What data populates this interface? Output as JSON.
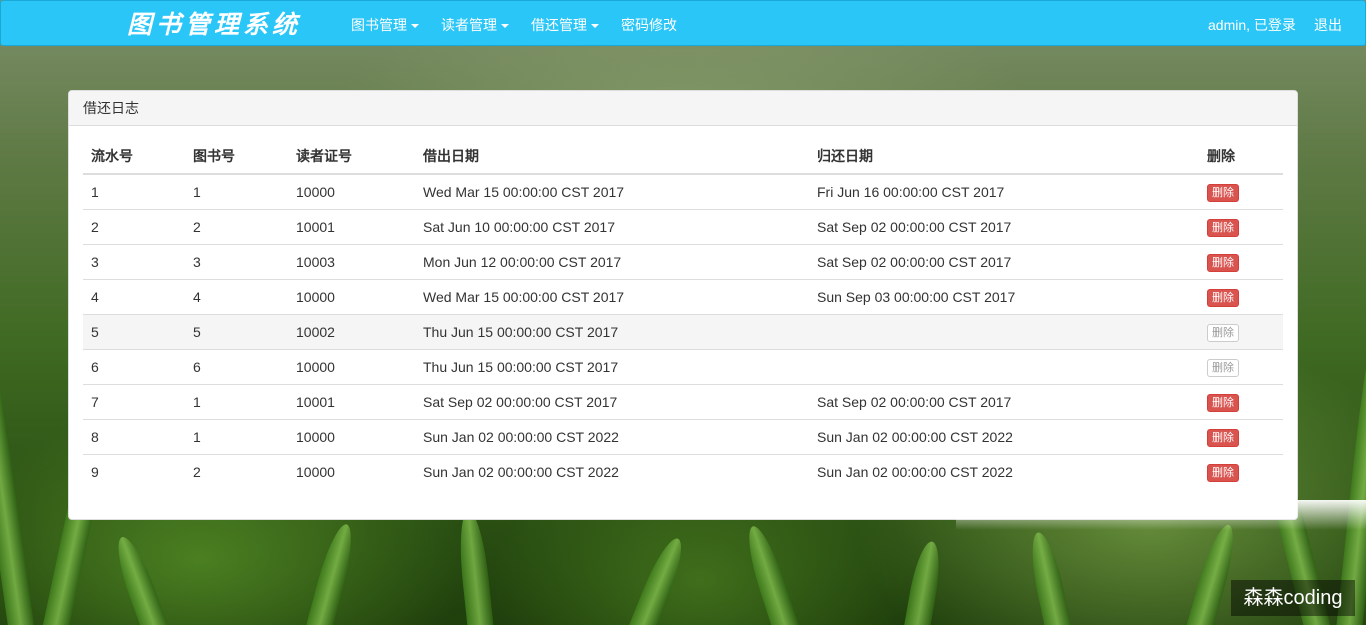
{
  "brand": "图书管理系统",
  "nav": {
    "items": [
      {
        "label": "图书管理",
        "dropdown": true
      },
      {
        "label": "读者管理",
        "dropdown": true
      },
      {
        "label": "借还管理",
        "dropdown": true
      },
      {
        "label": "密码修改",
        "dropdown": false
      }
    ],
    "user": "admin, 已登录",
    "logout": "退出"
  },
  "panel": {
    "title": "借还日志",
    "columns": [
      "流水号",
      "图书号",
      "读者证号",
      "借出日期",
      "归还日期",
      "删除"
    ],
    "rows": [
      {
        "sernum": "1",
        "book_id": "1",
        "reader_id": "10000",
        "lend_date": "Wed Mar 15 00:00:00 CST 2017",
        "back_date": "Fri Jun 16 00:00:00 CST 2017",
        "action": "删除",
        "enabled": true
      },
      {
        "sernum": "2",
        "book_id": "2",
        "reader_id": "10001",
        "lend_date": "Sat Jun 10 00:00:00 CST 2017",
        "back_date": "Sat Sep 02 00:00:00 CST 2017",
        "action": "删除",
        "enabled": true
      },
      {
        "sernum": "3",
        "book_id": "3",
        "reader_id": "10003",
        "lend_date": "Mon Jun 12 00:00:00 CST 2017",
        "back_date": "Sat Sep 02 00:00:00 CST 2017",
        "action": "删除",
        "enabled": true
      },
      {
        "sernum": "4",
        "book_id": "4",
        "reader_id": "10000",
        "lend_date": "Wed Mar 15 00:00:00 CST 2017",
        "back_date": "Sun Sep 03 00:00:00 CST 2017",
        "action": "删除",
        "enabled": true
      },
      {
        "sernum": "5",
        "book_id": "5",
        "reader_id": "10002",
        "lend_date": "Thu Jun 15 00:00:00 CST 2017",
        "back_date": "",
        "action": "删除",
        "enabled": false
      },
      {
        "sernum": "6",
        "book_id": "6",
        "reader_id": "10000",
        "lend_date": "Thu Jun 15 00:00:00 CST 2017",
        "back_date": "",
        "action": "删除",
        "enabled": false
      },
      {
        "sernum": "7",
        "book_id": "1",
        "reader_id": "10001",
        "lend_date": "Sat Sep 02 00:00:00 CST 2017",
        "back_date": "Sat Sep 02 00:00:00 CST 2017",
        "action": "删除",
        "enabled": true
      },
      {
        "sernum": "8",
        "book_id": "1",
        "reader_id": "10000",
        "lend_date": "Sun Jan 02 00:00:00 CST 2022",
        "back_date": "Sun Jan 02 00:00:00 CST 2022",
        "action": "删除",
        "enabled": true
      },
      {
        "sernum": "9",
        "book_id": "2",
        "reader_id": "10000",
        "lend_date": "Sun Jan 02 00:00:00 CST 2022",
        "back_date": "Sun Jan 02 00:00:00 CST 2022",
        "action": "删除",
        "enabled": true
      }
    ]
  },
  "watermark": "森森coding",
  "colors": {
    "navbar": "#2ac6f8",
    "danger": "#d9534f",
    "panel_heading": "#f5f5f5"
  }
}
